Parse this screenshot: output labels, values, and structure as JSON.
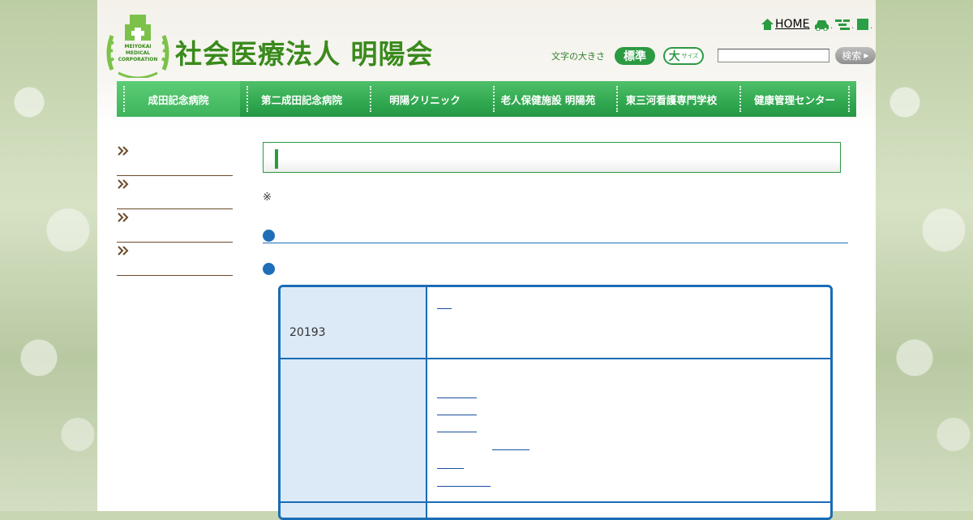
{
  "header": {
    "site_title": "社会医療法人 明陽会",
    "logo_text": "MEIYOKAI MEDICAL CORPORATION",
    "home_label": "HOME",
    "font_size_label": "文字の大きさ",
    "font_standard": "標準",
    "font_large": "大",
    "font_large_small": "サイズ",
    "search_button": "検索",
    "search_value": ""
  },
  "nav": {
    "items": [
      {
        "label": "成田記念病院"
      },
      {
        "label": "第二成田記念病院"
      },
      {
        "label": "明陽クリニック"
      },
      {
        "label": "老人保健施設 明陽苑"
      },
      {
        "label": "東三河看護専門学校"
      },
      {
        "label": "健康管理センター"
      }
    ]
  },
  "content": {
    "note_mark": "※",
    "table": {
      "row1_left": "20193"
    }
  },
  "colors": {
    "brand_green": "#2b9a41",
    "accent_blue": "#1f6fb8"
  }
}
